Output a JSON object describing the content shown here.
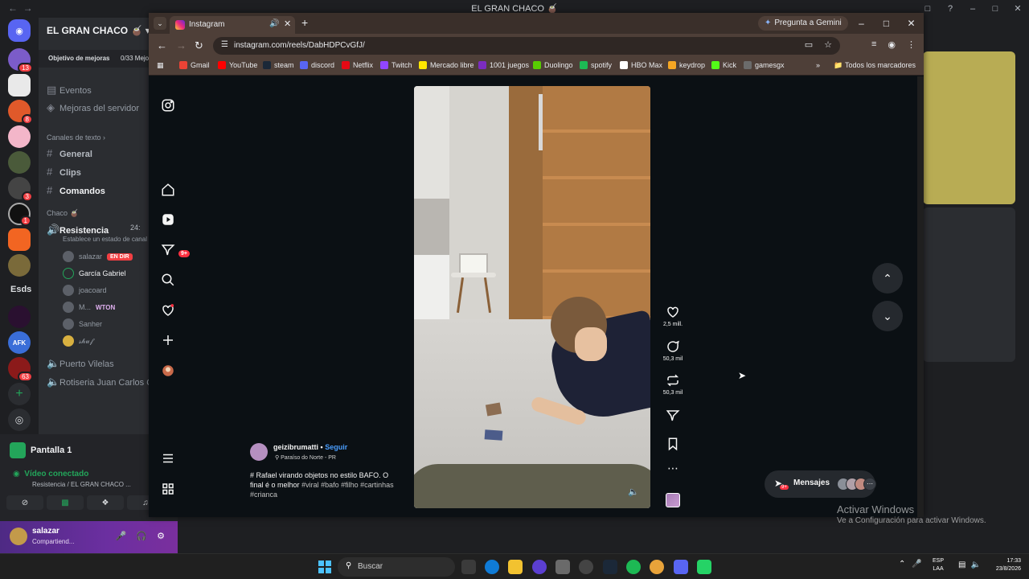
{
  "discord": {
    "window_title": "EL GRAN CHACO 🧉",
    "server_name": "EL GRAN CHACO 🧉",
    "boost_label": "Objetivo de mejoras",
    "boost_progress": "0/33 Mejo",
    "events_label": "Eventos",
    "server_boosts_label": "Mejoras del servidor",
    "text_category": "Canales de texto",
    "text_channels": [
      "General",
      "Clips",
      "Comandos"
    ],
    "voice_category": "Chaco 🧉",
    "voice_channel_active": "Resistencia",
    "voice_channel_time": "24:",
    "voice_status_placeholder": "Establece un estado de canal",
    "voice_users": [
      "salazar",
      "García Gabriel",
      "joacoard",
      "M...",
      "Sanher",
      "𝓈𝒽𝓊𝒻"
    ],
    "live_badge": "EN DIR",
    "wton_tag": "WTON",
    "other_voice_channels": [
      "Puerto Vilelas",
      "Rotiseria Juan Carlos Q"
    ],
    "server_badges": [
      "13",
      "8",
      "3",
      "1",
      "63"
    ],
    "server_text_item": "Esds",
    "server_afk": "AFK",
    "screen_share_label": "Pantalla 1",
    "voice_connected": "Vídeo conectado",
    "voice_connected_sub": "Resistencia / EL GRAN CHACO ...",
    "user_name": "salazar",
    "user_status": "Compartiend..."
  },
  "chrome": {
    "tab_title": "Instagram",
    "gemini_label": "Pregunta a Gemini",
    "url": "instagram.com/reels/DabHDPCvGfJ/",
    "bookmarks": [
      "Gmail",
      "YouTube",
      "steam",
      "discord",
      "Netflix",
      "Twitch",
      "Mercado libre",
      "1001 juegos",
      "Duolingo",
      "spotify",
      "HBO Max",
      "keydrop",
      "Kick",
      "gamesgx"
    ],
    "bookmark_colors": [
      "#ea4335",
      "#ff0000",
      "#1b2838",
      "#5865f2",
      "#e50914",
      "#9146ff",
      "#ffe600",
      "#7b2cbf",
      "#58cc02",
      "#1db954",
      "#ffffff",
      "#f5a623",
      "#53fc18",
      "#6b6b6b"
    ],
    "bookmarks_folder": "Todos los marcadores"
  },
  "instagram": {
    "nav_badge": "9+",
    "likes": "2,5 mill.",
    "comments": "50,3 mil",
    "reposts": "50,3 mil",
    "username": "geizibrumatti",
    "separator": "•",
    "follow": "Seguir",
    "location": "Paraíso do Norte - PR",
    "caption_text": "# Rafael virando objetos no estilo BAFO. O final é o melhor",
    "caption_tags": "#viral #bafo #filho #cartinhas #crianca",
    "messages_label": "Mensajes",
    "messages_badge": "9+"
  },
  "windows": {
    "activate_title": "Activar Windows",
    "activate_sub": "Ve a Configuración para activar Windows.",
    "search_placeholder": "Buscar",
    "lang": "ESP",
    "lang_sub": "LAA",
    "time": "17:33",
    "date": "23/8/2026"
  }
}
